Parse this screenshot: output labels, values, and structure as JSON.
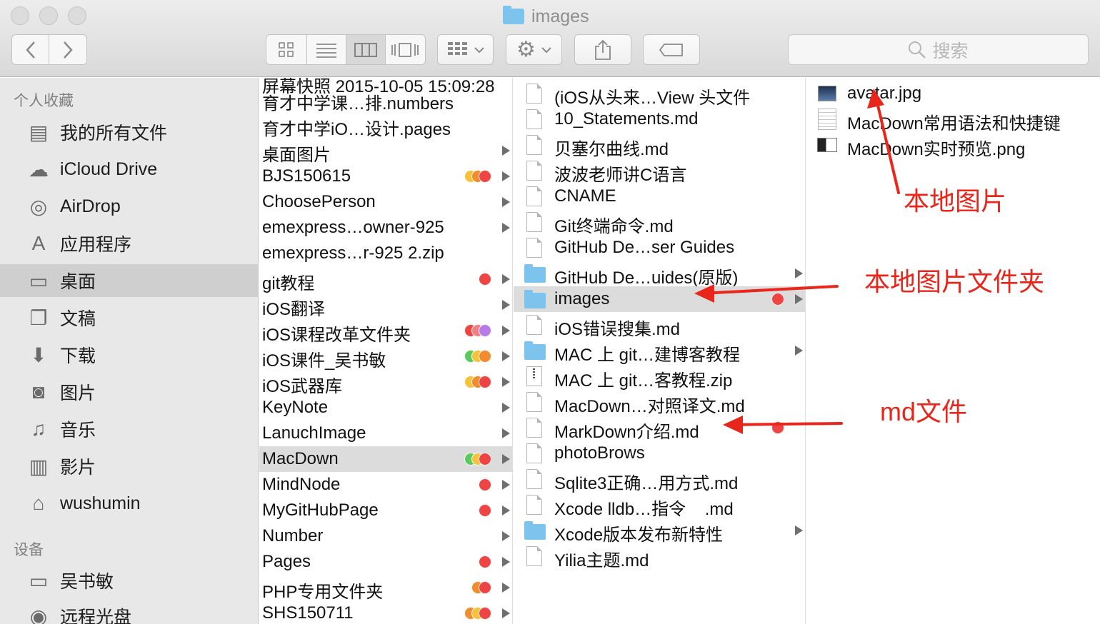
{
  "window": {
    "title": "images"
  },
  "toolbar": {
    "search_placeholder": "搜索"
  },
  "sidebar": {
    "favorites_heading": "个人收藏",
    "favorites": [
      {
        "label": "我的所有文件",
        "icon": "all-files-icon"
      },
      {
        "label": "iCloud Drive",
        "icon": "cloud-icon"
      },
      {
        "label": "AirDrop",
        "icon": "airdrop-icon"
      },
      {
        "label": "应用程序",
        "icon": "applications-icon"
      },
      {
        "label": "桌面",
        "icon": "desktop-icon",
        "selected": true
      },
      {
        "label": "文稿",
        "icon": "documents-icon"
      },
      {
        "label": "下载",
        "icon": "download-icon"
      },
      {
        "label": "图片",
        "icon": "camera-icon"
      },
      {
        "label": "音乐",
        "icon": "music-icon"
      },
      {
        "label": "影片",
        "icon": "movie-icon"
      },
      {
        "label": "wushumin",
        "icon": "home-icon"
      }
    ],
    "devices_heading": "设备",
    "devices": [
      {
        "label": "吴书敏",
        "icon": "laptop-icon"
      },
      {
        "label": "远程光盘",
        "icon": "disc-icon"
      }
    ]
  },
  "column1": {
    "items": [
      {
        "name": "育才中学课…排.numbers",
        "folder": false,
        "tags": []
      },
      {
        "name": "育才中学iO…设计.pages",
        "folder": false,
        "tags": []
      },
      {
        "name": "桌面图片",
        "folder": true,
        "tags": []
      },
      {
        "name": "BJS150615",
        "folder": true,
        "tags": [
          "#f5c33b",
          "#f28a2e",
          "#ee4444"
        ]
      },
      {
        "name": "ChoosePerson",
        "folder": true,
        "tags": []
      },
      {
        "name": "emexpress…owner-925",
        "folder": true,
        "tags": []
      },
      {
        "name": "emexpress…r-925 2.zip",
        "folder": false,
        "tags": []
      },
      {
        "name": "git教程",
        "folder": true,
        "tags": [
          "#ee4444"
        ]
      },
      {
        "name": "iOS翻译",
        "folder": true,
        "tags": []
      },
      {
        "name": "iOS课程改革文件夹",
        "folder": true,
        "tags": [
          "#ee4444",
          "#f08080",
          "#b77be6"
        ]
      },
      {
        "name": "iOS课件_吴书敏",
        "folder": true,
        "tags": [
          "#5cc95c",
          "#f5c33b",
          "#f28a2e"
        ]
      },
      {
        "name": "iOS武器库",
        "folder": true,
        "tags": [
          "#f5c33b",
          "#f28a2e",
          "#ee4444"
        ]
      },
      {
        "name": "KeyNote",
        "folder": true,
        "tags": []
      },
      {
        "name": "LanuchImage",
        "folder": true,
        "tags": []
      },
      {
        "name": "MacDown",
        "folder": true,
        "selected": true,
        "tags": [
          "#5cc95c",
          "#f5c33b",
          "#ee4444"
        ]
      },
      {
        "name": "MindNode",
        "folder": true,
        "tags": [
          "#ee4444"
        ]
      },
      {
        "name": "MyGitHubPage",
        "folder": true,
        "tags": [
          "#ee4444"
        ]
      },
      {
        "name": "Number",
        "folder": true,
        "tags": []
      },
      {
        "name": "Pages",
        "folder": true,
        "tags": [
          "#ee4444"
        ]
      },
      {
        "name": "PHP专用文件夹",
        "folder": true,
        "tags": [
          "#f28a2e",
          "#ee4444"
        ]
      },
      {
        "name": "SHS150711",
        "folder": true,
        "tags": [
          "#f28a2e",
          "#f5c33b",
          "#ee4444"
        ]
      }
    ]
  },
  "column2": {
    "items": [
      {
        "name": "(iOS从头来…View 头文件",
        "kind": "doc"
      },
      {
        "name": "10_Statements.md",
        "kind": "doc"
      },
      {
        "name": "贝塞尔曲线.md",
        "kind": "doc"
      },
      {
        "name": "波波老师讲C语言",
        "kind": "doc"
      },
      {
        "name": "CNAME",
        "kind": "doc"
      },
      {
        "name": "Git终端命令.md",
        "kind": "doc"
      },
      {
        "name": "GitHub De…ser Guides",
        "kind": "doc"
      },
      {
        "name": "GitHub De…uides(原版)",
        "kind": "folder"
      },
      {
        "name": "images",
        "kind": "folder",
        "selected": true,
        "tags": [
          "#ee4444"
        ]
      },
      {
        "name": "iOS错误搜集.md",
        "kind": "doc"
      },
      {
        "name": "MAC 上 git…建博客教程",
        "kind": "folder"
      },
      {
        "name": "MAC 上 git…客教程.zip",
        "kind": "zip"
      },
      {
        "name": "MacDown…对照译文.md",
        "kind": "doc"
      },
      {
        "name": "MarkDown介绍.md",
        "kind": "doc",
        "tags": [
          "#ee4444"
        ]
      },
      {
        "name": "photoBrows",
        "kind": "doc"
      },
      {
        "name": "Sqlite3正确…用方式.md",
        "kind": "doc"
      },
      {
        "name": "Xcode lldb…指令    .md",
        "kind": "doc"
      },
      {
        "name": "Xcode版本发布新特性",
        "kind": "folder"
      },
      {
        "name": "Yilia主题.md",
        "kind": "doc"
      }
    ]
  },
  "column3": {
    "items": [
      {
        "name": "avatar.jpg",
        "kind": "image"
      },
      {
        "name": "MacDown常用语法和快捷键",
        "kind": "text"
      },
      {
        "name": "MacDown实时预览.png",
        "kind": "png"
      }
    ]
  },
  "annotations": {
    "local_image": "本地图片",
    "local_image_folder": "本地图片文件夹",
    "md_file": "md文件",
    "color": "#e8261b"
  }
}
